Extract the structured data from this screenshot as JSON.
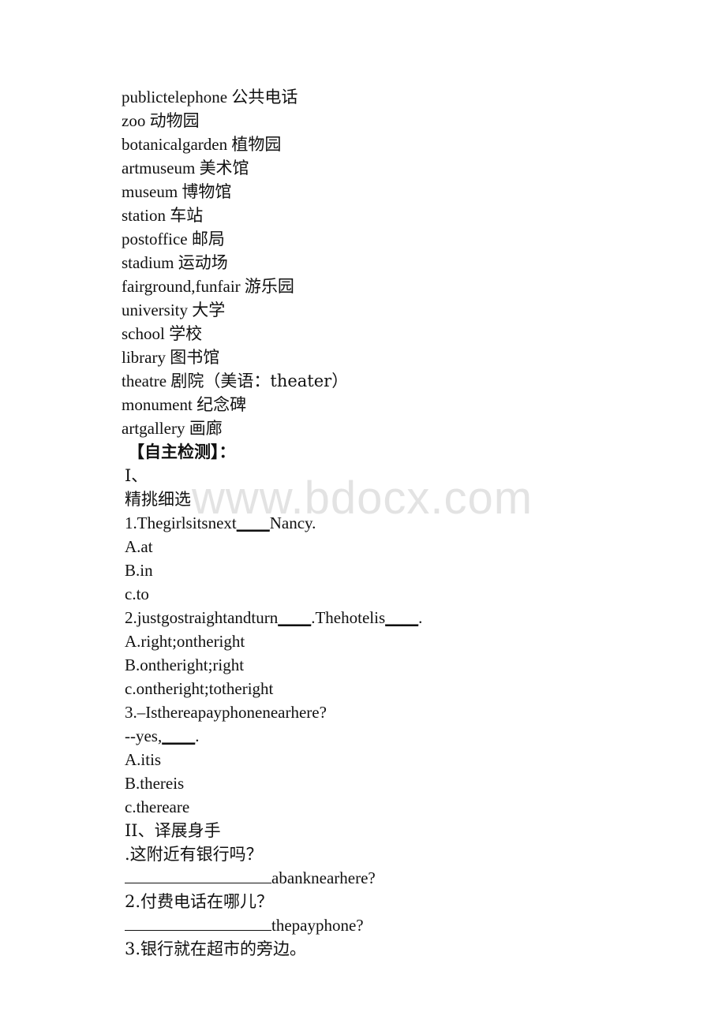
{
  "document": {
    "background_color": "#ffffff",
    "text_color": "#111111"
  },
  "watermark": {
    "text": "www.bdocx.com",
    "color": "#e3e3e3"
  },
  "vocabulary": [
    {
      "term": "publictelephone",
      "translation": "公共电话"
    },
    {
      "term": "zoo",
      "translation": "动物园"
    },
    {
      "term": "botanicalgarden",
      "translation": "植物园"
    },
    {
      "term": "artmuseum",
      "translation": "美术馆"
    },
    {
      "term": "museum",
      "translation": "博物馆"
    },
    {
      "term": "station",
      "translation": "车站"
    },
    {
      "term": "postoffice",
      "translation": "邮局"
    },
    {
      "term": "stadium",
      "translation": "运动场"
    },
    {
      "term": "fairground,funfair",
      "translation": "游乐园"
    },
    {
      "term": "university",
      "translation": "大学"
    },
    {
      "term": "school",
      "translation": "学校"
    },
    {
      "term": "library",
      "translation": "图书馆"
    },
    {
      "term": "theatre",
      "translation": "剧院（美语：theater）"
    },
    {
      "term": "monument",
      "translation": "纪念碑"
    },
    {
      "term": "artgallery",
      "translation": "画廊"
    }
  ],
  "self_test": {
    "heading": "【自主检测】："
  },
  "section_one": {
    "label": "I、",
    "title": "精挑细选",
    "questions": [
      {
        "stem_before": "1.Thegirlsitsnext",
        "stem_blank": "____",
        "stem_after": "Nancy.",
        "options": [
          "A.at",
          "B.in",
          "c.to"
        ]
      },
      {
        "stem_before": "2.justgostraightandturn",
        "stem_blank": "____",
        "stem_middle": ".Thehotelis",
        "stem_blank2": "____",
        "stem_after": ".",
        "options": [
          "A.right;ontheright",
          "B.ontheright;right",
          "c.ontheright;totheright"
        ]
      },
      {
        "stem_before": "3.–Isthereapayphonenearhere?",
        "answer_before": "--yes,",
        "answer_blank": "____",
        "answer_after": ".",
        "options": [
          "A.itis",
          "B.thereis",
          "c.thereare"
        ]
      }
    ]
  },
  "section_two": {
    "label": "II、",
    "title": "译展身手",
    "items": [
      {
        "prompt": ".这附近有银行吗？",
        "answer_suffix": "abanknearhere?"
      },
      {
        "prompt": "2.付费电话在哪儿？",
        "answer_suffix": "thepayphone?"
      },
      {
        "prompt": "3.银行就在超市的旁边。",
        "answer_suffix": ""
      }
    ]
  }
}
